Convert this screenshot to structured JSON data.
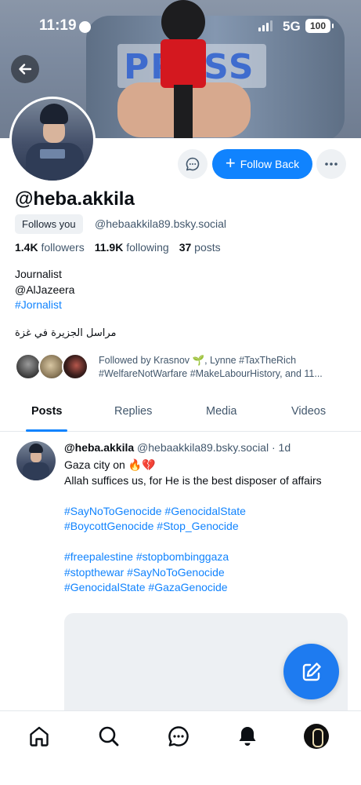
{
  "status_bar": {
    "time": "11:19",
    "network": "5G",
    "battery": "100"
  },
  "profile": {
    "display_name": "@heba.akkila",
    "follows_you": "Follows you",
    "handle": "@hebaakkila89.bsky.social",
    "followers_count": "1.4K",
    "followers_label": "followers",
    "following_count": "11.9K",
    "following_label": "following",
    "posts_count": "37",
    "posts_label": "posts",
    "bio_line1": "Journalist",
    "bio_line2": "@AlJazeera",
    "bio_line3": "#Jornalist",
    "bio_arabic": "مراسل الجزيرة في غزة",
    "followed_by_line1": "Followed by Krasnov 🌱, Lynne #TaxTheRich",
    "followed_by_line2": "#WelfareNotWarfare #MakeLabourHistory, and 11..."
  },
  "actions": {
    "follow_back_label": "Follow Back"
  },
  "tabs": [
    {
      "label": "Posts",
      "active": true
    },
    {
      "label": "Replies",
      "active": false
    },
    {
      "label": "Media",
      "active": false
    },
    {
      "label": "Videos",
      "active": false
    }
  ],
  "post": {
    "author": "@heba.akkila",
    "handle": "@hebaakkila89.bsky.social",
    "separator": "·",
    "age": "1d",
    "line1": "Gaza city on 🔥💔",
    "line2": "Allah suffices us, for He is the best disposer of affairs",
    "tags1": "#SayNoToGenocide #GenocidalState",
    "tags2": "#BoycottGenocide #Stop_Genocide",
    "tags3": "#freepalestine #stopbombinggaza",
    "tags4": "#stopthewar #SayNoToGenocide",
    "tags5": "#GenocidalState  #GazaGenocide"
  },
  "banner_text": "PRESS",
  "colors": {
    "accent": "#1083fe",
    "compose": "#1e7bf0",
    "muted": "#42576c",
    "chip": "#eef1f4"
  },
  "icons": {
    "back": "arrow-left-icon",
    "message": "chat-bubble-icon",
    "more": "more-horizontal-icon",
    "compose": "compose-icon",
    "nav": [
      "home-icon",
      "search-icon",
      "chat-icon",
      "bell-icon",
      "profile-avatar"
    ]
  }
}
